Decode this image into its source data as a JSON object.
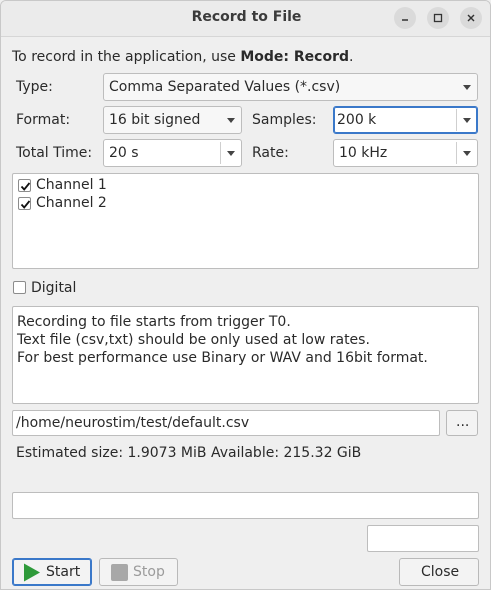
{
  "window": {
    "title": "Record to File"
  },
  "intro": {
    "prefix": "To record in the application, use ",
    "mode_text": "Mode: Record",
    "suffix": "."
  },
  "type": {
    "label": "Type:",
    "value": "Comma Separated Values (*.csv)"
  },
  "format": {
    "label": "Format:",
    "value": "16 bit signed"
  },
  "samples": {
    "label": "Samples:",
    "value": "200 k"
  },
  "total_time": {
    "label": "Total Time:",
    "value": "20 s"
  },
  "rate": {
    "label": "Rate:",
    "value": "10 kHz"
  },
  "channels": [
    {
      "label": "Channel 1",
      "checked": true
    },
    {
      "label": "Channel 2",
      "checked": true
    }
  ],
  "digital": {
    "label": "Digital",
    "checked": false
  },
  "info": {
    "line1": "Recording to file starts from trigger T0.",
    "line2": "Text file (csv,txt) should be only used at low rates.",
    "line3": "For best performance use Binary or WAV and 16bit format."
  },
  "file": {
    "path": "/home/neurostim/test/default.csv",
    "browse_label": "..."
  },
  "estimate": {
    "text": "Estimated size: 1.9073 MiB Available: 215.32 GiB"
  },
  "buttons": {
    "start": "Start",
    "stop": "Stop",
    "close": "Close"
  },
  "colors": {
    "accent": "#3a78c9",
    "start_icon": "#2e9a3a"
  }
}
